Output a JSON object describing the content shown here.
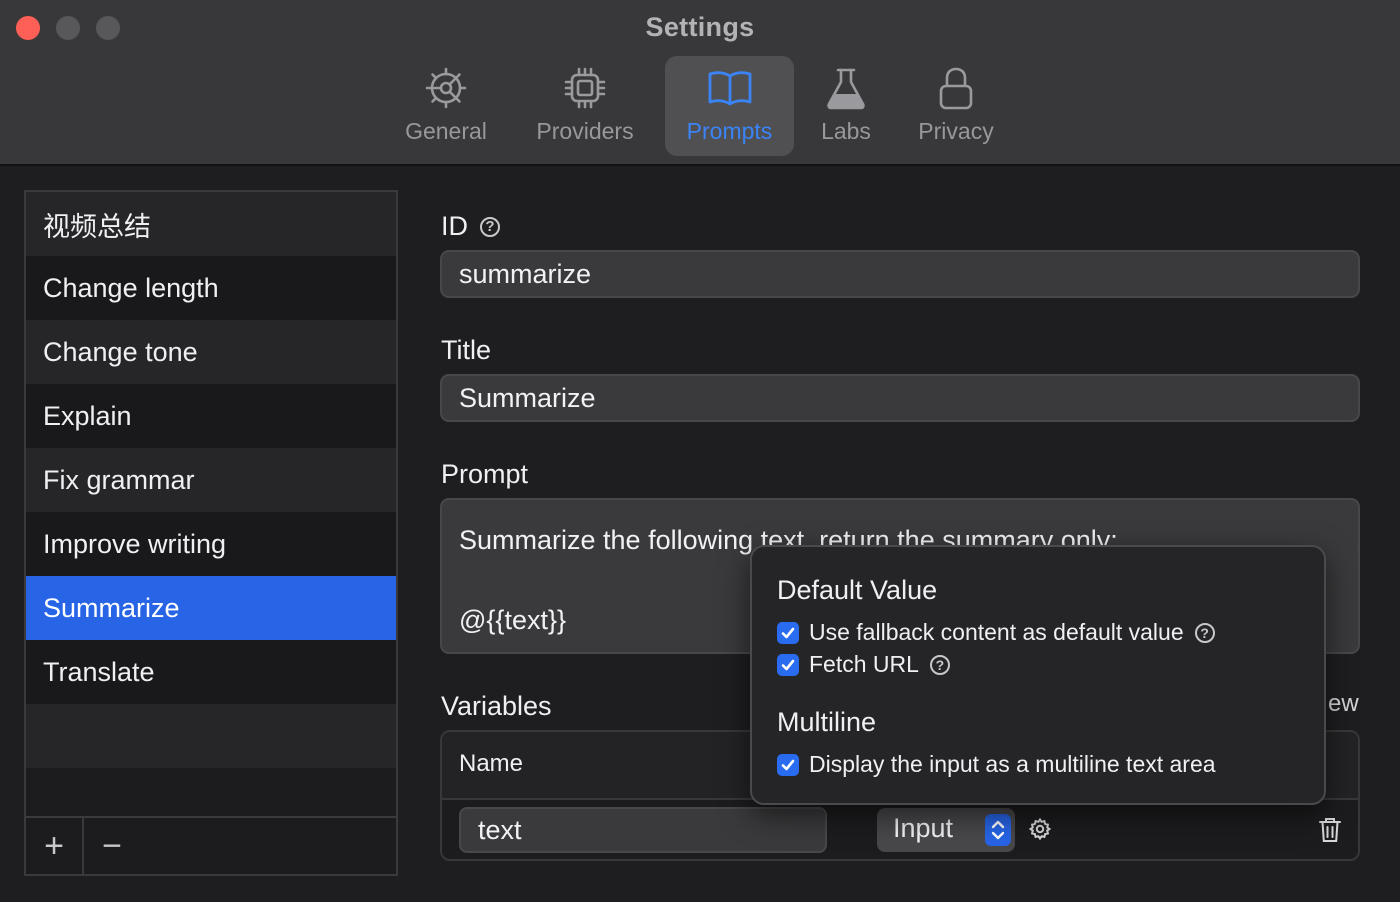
{
  "window": {
    "title": "Settings"
  },
  "tabs": [
    {
      "label": "General",
      "icon": "gear-icon"
    },
    {
      "label": "Providers",
      "icon": "chip-icon"
    },
    {
      "label": "Prompts",
      "icon": "book-icon",
      "active": true
    },
    {
      "label": "Labs",
      "icon": "flask-icon"
    },
    {
      "label": "Privacy",
      "icon": "lock-icon"
    }
  ],
  "sidebar": {
    "items": [
      {
        "label": "视频总结"
      },
      {
        "label": "Change length"
      },
      {
        "label": "Change tone"
      },
      {
        "label": "Explain"
      },
      {
        "label": "Fix grammar"
      },
      {
        "label": "Improve writing"
      },
      {
        "label": "Summarize",
        "selected": true
      },
      {
        "label": "Translate"
      },
      {
        "label": ""
      }
    ],
    "add_label": "+",
    "remove_label": "−"
  },
  "form": {
    "id_label": "ID",
    "id_value": "summarize",
    "title_label": "Title",
    "title_value": "Summarize",
    "prompt_label": "Prompt",
    "prompt_value": "Summarize the following text, return the summary only:\n\n@{{text}}",
    "variables_label": "Variables",
    "preview_tail": "ew"
  },
  "variables": {
    "header_name": "Name",
    "rows": [
      {
        "name": "text",
        "type": "Input"
      }
    ]
  },
  "popover": {
    "default_value_heading": "Default Value",
    "use_fallback_label": "Use fallback content as default value",
    "use_fallback_checked": true,
    "fetch_url_label": "Fetch URL",
    "fetch_url_checked": true,
    "multiline_heading": "Multiline",
    "multiline_label": "Display the input as a multiline text area",
    "multiline_checked": true
  },
  "colors": {
    "accent": "#2764e6",
    "active_tab_text": "#3b84f5",
    "close_button": "#fe5f57"
  }
}
